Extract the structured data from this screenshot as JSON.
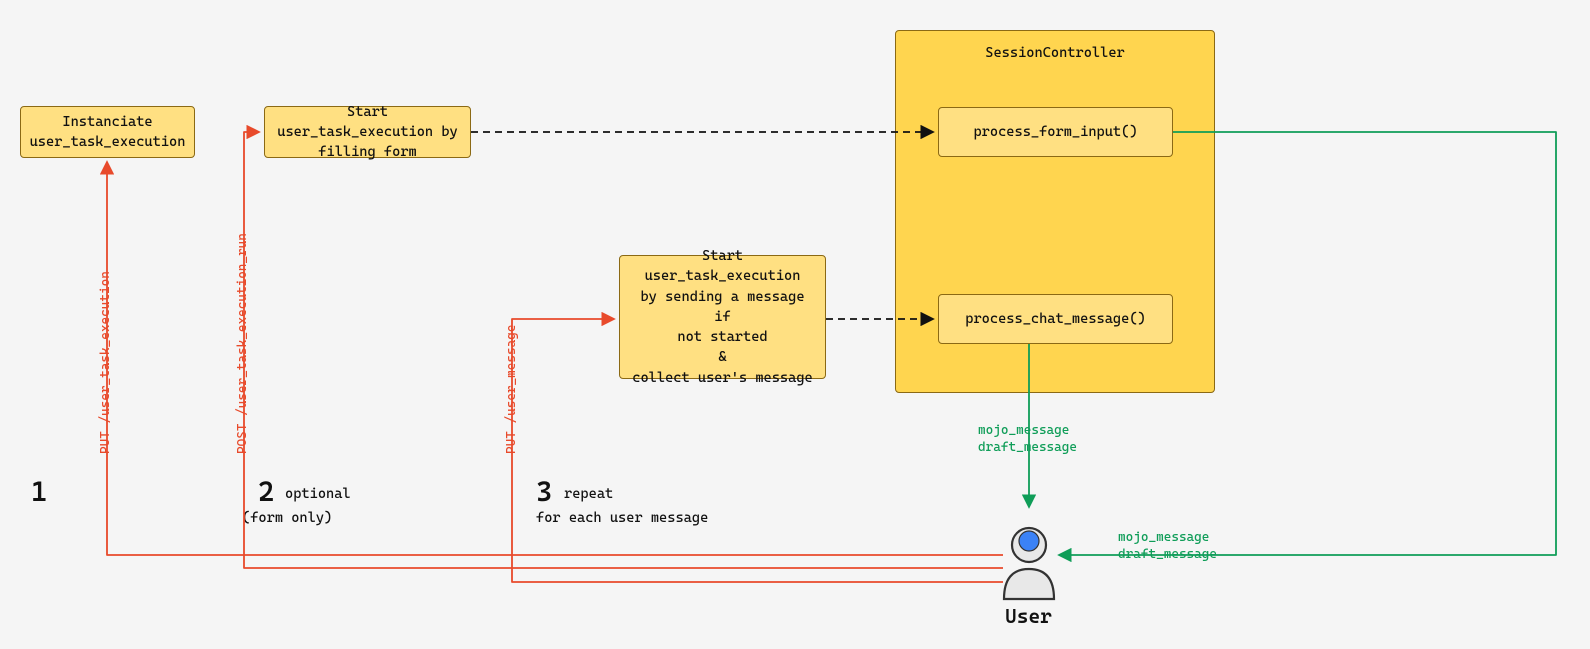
{
  "boxes": {
    "instanciate": "Instanciate\nuser_task_execution",
    "start_form": "Start user_task_execution by\nfilling form",
    "start_msg": "Start user_task_execution\nby sending a message if\nnot started\n&\ncollect user's message",
    "session_controller": "SessionController",
    "process_form": "process_form_input()",
    "process_chat": "process_chat_message()"
  },
  "edges": {
    "put_ute": "PUT /user_task_execution",
    "post_ute_run": "POST /user_task_execution_run",
    "put_user_message": "PUT /user_message",
    "mojo_draft_1": "mojo_message\ndraft_message",
    "mojo_draft_2": "mojo_message\ndraft_message"
  },
  "steps": {
    "s1_num": "1",
    "s2_num": "2",
    "s2_sub": "optional",
    "s2_sub2": "(form only)",
    "s3_num": "3",
    "s3_sub": "repeat",
    "s3_sub2": "for each user message"
  },
  "user_label": "User"
}
